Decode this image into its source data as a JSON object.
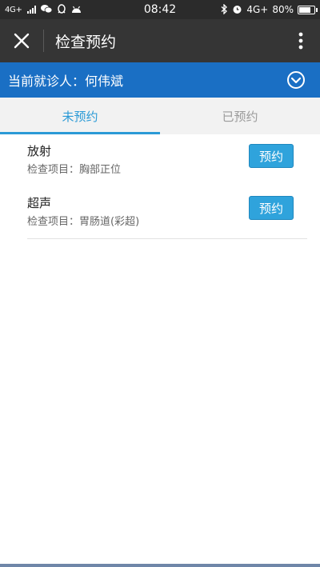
{
  "status_bar": {
    "network_left": "4G+",
    "time": "08:42",
    "network_right": "4G+",
    "battery_text": "80%",
    "battery_level": 0.8,
    "icons": [
      "signal-icon",
      "wechat-icon",
      "qq-icon",
      "android-icon",
      "bluetooth-icon",
      "alarm-icon",
      "battery-icon"
    ]
  },
  "header": {
    "title": "检查预约",
    "close_icon": "close-icon",
    "more_icon": "more-vertical-icon"
  },
  "patient": {
    "label": "当前就诊人：",
    "name": "何伟斌",
    "dropdown_icon": "chevron-down-circle-icon"
  },
  "tabs": [
    {
      "label": "未预约",
      "active": true
    },
    {
      "label": "已预约",
      "active": false
    }
  ],
  "exams": [
    {
      "name": "放射",
      "detail": "检查项目：胸部正位",
      "button": "预约"
    },
    {
      "name": "超声",
      "detail": "检查项目：胃肠道(彩超)",
      "button": "预约"
    }
  ],
  "colors": {
    "status_bar": "#2b2b2b",
    "title_bar": "#353535",
    "patient_bar": "#1a6fc4",
    "accent": "#2b9ad6",
    "button": "#2fa3dc"
  }
}
